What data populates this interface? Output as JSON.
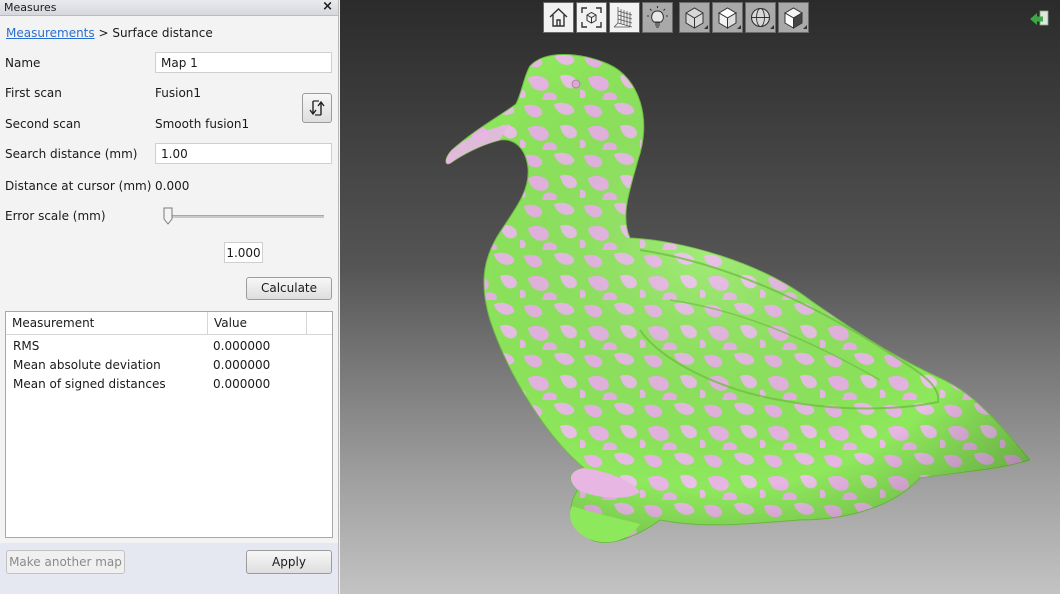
{
  "panel": {
    "title": "Measures",
    "close_glyph": "×",
    "breadcrumb": {
      "link": "Measurements",
      "separator": " > ",
      "current": "Surface distance"
    },
    "name_label": "Name",
    "name_value": "Map 1",
    "first_scan_label": "First scan",
    "first_scan_value": "Fusion1",
    "second_scan_label": "Second scan",
    "second_scan_value": "Smooth fusion1",
    "search_distance_label": "Search distance (mm)",
    "search_distance_value": "1.00",
    "distance_cursor_label": "Distance at cursor (mm)",
    "distance_cursor_value": "0.000",
    "error_scale_label": "Error scale (mm)",
    "error_scale_value": "1.000",
    "error_scale_slider_level": 0.0,
    "calculate_label": "Calculate",
    "table": {
      "headers": [
        "Measurement",
        "Value"
      ],
      "rows": [
        {
          "measurement": "RMS",
          "value": "0.000000"
        },
        {
          "measurement": "Mean absolute deviation",
          "value": "0.000000"
        },
        {
          "measurement": "Mean of signed distances",
          "value": "0.000000"
        }
      ]
    },
    "make_another_label": "Make another map",
    "apply_label": "Apply"
  },
  "viewport": {
    "toolbar_icons": [
      "home-icon",
      "fit-view-icon",
      "grid-icon",
      "lightbulb-icon",
      "shaded-cube-icon",
      "solid-cube-icon",
      "sphere-wireframe-icon",
      "dark-cube-icon"
    ],
    "colors": {
      "mesh_pink": "#e7b6e3",
      "mesh_green": "#8ee85c",
      "accent_exit": "#3aa845"
    }
  }
}
